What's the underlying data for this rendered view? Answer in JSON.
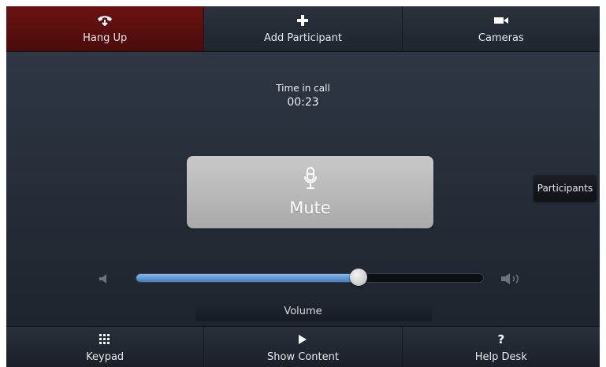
{
  "top_bar": {
    "hang_up": {
      "label": "Hang Up",
      "icon": "phone-hangup-icon"
    },
    "add_participant": {
      "label": "Add Participant",
      "icon": "plus-icon"
    },
    "cameras": {
      "label": "Cameras",
      "icon": "video-camera-icon"
    }
  },
  "call": {
    "time_label": "Time in call",
    "time_value": "00:23"
  },
  "mute_button": {
    "label": "Mute",
    "icon": "microphone-icon"
  },
  "participants_button": {
    "label": "Participants"
  },
  "volume": {
    "label": "Volume",
    "level": 0.64,
    "low_icon": "speaker-low-icon",
    "high_icon": "speaker-high-icon"
  },
  "bottom_bar": {
    "keypad": {
      "label": "Keypad",
      "icon": "keypad-grid-icon"
    },
    "show_content": {
      "label": "Show Content",
      "icon": "play-icon"
    },
    "help_desk": {
      "label": "Help Desk",
      "icon": "question-mark-icon"
    }
  },
  "colors": {
    "hang_up_bg": "#5a0f0f",
    "volume_fill": "#5b9bd5",
    "mute_bg": "#b9b9b9"
  }
}
